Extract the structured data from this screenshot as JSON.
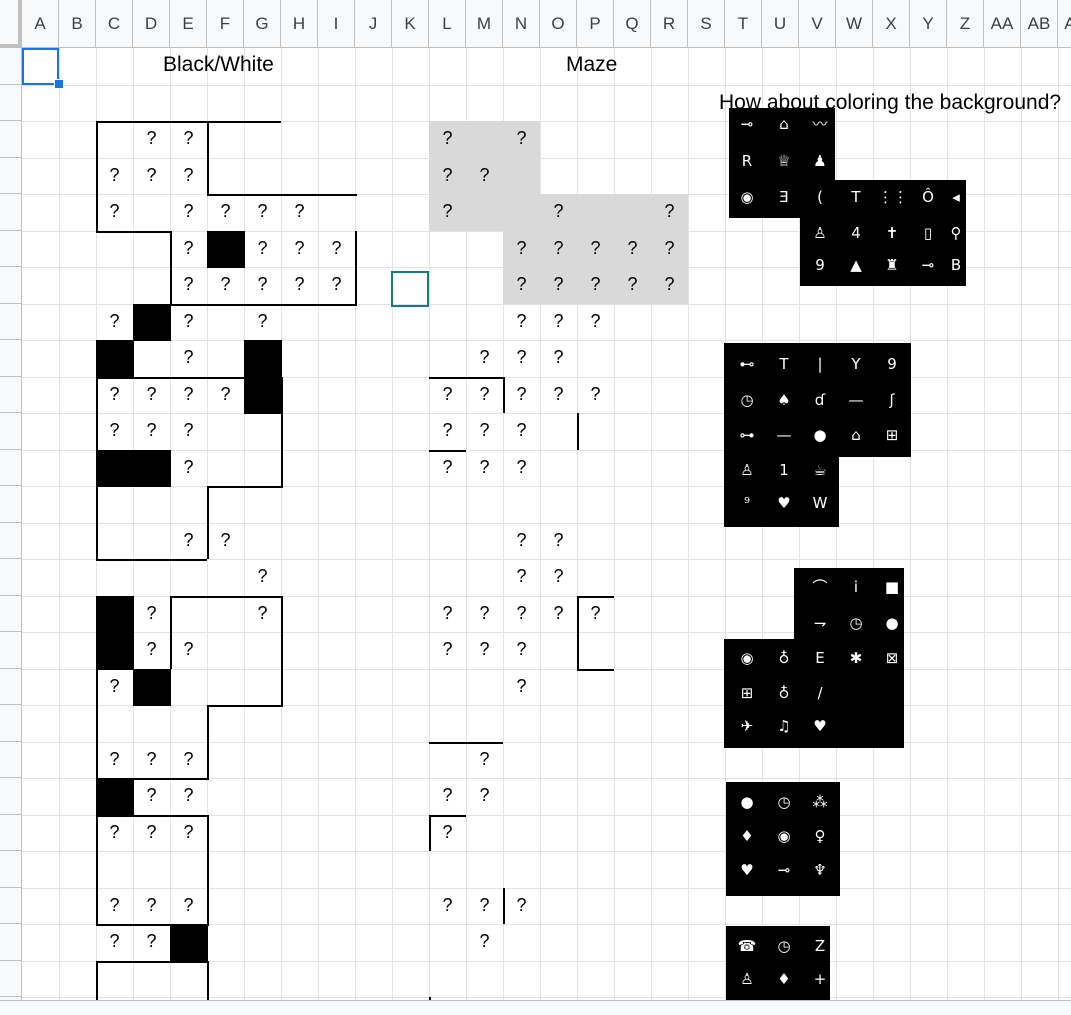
{
  "columns": [
    "A",
    "B",
    "C",
    "D",
    "E",
    "F",
    "G",
    "H",
    "I",
    "J",
    "K",
    "L",
    "M",
    "N",
    "O",
    "P",
    "Q",
    "R",
    "S",
    "T",
    "U",
    "V",
    "W",
    "X",
    "Y",
    "Z",
    "AA",
    "AB",
    "AC"
  ],
  "titles": {
    "black_white": "Black/White",
    "maze": "Maze",
    "coloring_note": "How about coloring the background?"
  },
  "mark": "?",
  "colors": {
    "selection": "#1a73e8",
    "teal_cell": "#137c7c",
    "gray_fill": "#d9d9d9"
  },
  "puzzles_bw": [
    {
      "questions": [
        [
          1,
          3
        ],
        [
          1,
          4
        ],
        [
          2,
          2
        ],
        [
          2,
          3
        ],
        [
          2,
          4
        ],
        [
          3,
          2
        ],
        [
          3,
          4
        ],
        [
          3,
          5
        ],
        [
          3,
          6
        ],
        [
          3,
          7
        ],
        [
          4,
          4
        ],
        [
          4,
          6
        ],
        [
          4,
          7
        ],
        [
          4,
          8
        ],
        [
          5,
          4
        ],
        [
          5,
          5
        ],
        [
          5,
          6
        ],
        [
          5,
          7
        ],
        [
          5,
          8
        ]
      ],
      "blacks": [
        [
          4,
          5
        ]
      ]
    },
    {
      "questions": [
        [
          1,
          2
        ],
        [
          1,
          4
        ],
        [
          1,
          6
        ],
        [
          2,
          4
        ],
        [
          3,
          2
        ],
        [
          3,
          3
        ],
        [
          3,
          4
        ],
        [
          3,
          5
        ],
        [
          4,
          2
        ],
        [
          4,
          3
        ],
        [
          4,
          4
        ],
        [
          5,
          4
        ]
      ],
      "blacks": [
        [
          1,
          3
        ],
        [
          2,
          2
        ],
        [
          2,
          6
        ],
        [
          3,
          6
        ],
        [
          5,
          2
        ],
        [
          5,
          3
        ]
      ]
    },
    {
      "questions": [
        [
          1,
          4
        ],
        [
          1,
          5
        ],
        [
          2,
          6
        ],
        [
          3,
          3
        ],
        [
          3,
          6
        ],
        [
          4,
          3
        ],
        [
          4,
          4
        ],
        [
          5,
          2
        ]
      ],
      "blacks": [
        [
          3,
          2
        ],
        [
          4,
          2
        ],
        [
          5,
          3
        ]
      ]
    },
    {
      "questions": [
        [
          1,
          2
        ],
        [
          1,
          3
        ],
        [
          1,
          4
        ],
        [
          2,
          3
        ],
        [
          2,
          4
        ],
        [
          3,
          2
        ],
        [
          3,
          3
        ],
        [
          3,
          4
        ]
      ],
      "blacks": [
        [
          2,
          2
        ]
      ]
    },
    {
      "questions": [
        [
          1,
          2
        ],
        [
          1,
          3
        ],
        [
          1,
          4
        ],
        [
          2,
          2
        ],
        [
          2,
          3
        ]
      ],
      "blacks": [
        [
          2,
          4
        ]
      ]
    }
  ],
  "puzzles_maze": [
    {
      "questions": [
        [
          1,
          11
        ],
        [
          1,
          13
        ],
        [
          2,
          11
        ],
        [
          2,
          12
        ],
        [
          3,
          11
        ],
        [
          3,
          14
        ],
        [
          3,
          17
        ],
        [
          4,
          13
        ],
        [
          4,
          14
        ],
        [
          4,
          15
        ],
        [
          4,
          16
        ],
        [
          4,
          17
        ],
        [
          5,
          13
        ],
        [
          5,
          14
        ],
        [
          5,
          15
        ],
        [
          5,
          16
        ],
        [
          5,
          17
        ]
      ]
    },
    {
      "questions": [
        [
          1,
          13
        ],
        [
          1,
          14
        ],
        [
          1,
          15
        ],
        [
          2,
          12
        ],
        [
          2,
          13
        ],
        [
          2,
          14
        ],
        [
          3,
          11
        ],
        [
          3,
          12
        ],
        [
          3,
          13
        ],
        [
          3,
          14
        ],
        [
          3,
          15
        ],
        [
          4,
          11
        ],
        [
          4,
          12
        ],
        [
          4,
          13
        ],
        [
          5,
          11
        ],
        [
          5,
          12
        ],
        [
          5,
          13
        ]
      ]
    },
    {
      "questions": [
        [
          1,
          13
        ],
        [
          1,
          14
        ],
        [
          2,
          13
        ],
        [
          2,
          14
        ],
        [
          3,
          11
        ],
        [
          3,
          12
        ],
        [
          3,
          13
        ],
        [
          3,
          14
        ],
        [
          3,
          15
        ],
        [
          4,
          11
        ],
        [
          4,
          12
        ],
        [
          4,
          13
        ],
        [
          5,
          13
        ]
      ]
    },
    {
      "questions": [
        [
          1,
          12
        ],
        [
          2,
          11
        ],
        [
          2,
          12
        ],
        [
          3,
          11
        ]
      ]
    },
    {
      "questions": [
        [
          1,
          11
        ],
        [
          1,
          12
        ],
        [
          1,
          13
        ],
        [
          2,
          12
        ]
      ]
    }
  ],
  "icon_blocks": [
    {
      "icons": [
        "⊸",
        "⌂",
        "〰",
        "R",
        "♕",
        "♟",
        "◉",
        "Ǝ",
        "(",
        "T",
        "⋮⋮",
        "Ô",
        "◂",
        "♙",
        "4",
        "✝",
        "▯",
        "⚲",
        "9",
        "▲",
        "♜",
        "⊸",
        "B"
      ]
    },
    {
      "icons": [
        "⊷",
        "T",
        "|",
        "Y",
        "9",
        "◷",
        "♠",
        "ɗ",
        "—",
        "ʃ",
        "⊶",
        "—",
        "●",
        "⌂",
        "⊞",
        "♙",
        "1",
        "☕",
        "⁹",
        "♥",
        "W"
      ]
    },
    {
      "icons": [
        "⌒",
        "i",
        "■",
        "⇁",
        "◷",
        "●",
        "◉",
        "♁",
        "E",
        "✱",
        "⊠",
        "⊞",
        "♁",
        "/",
        "✈",
        "♫",
        "♥"
      ]
    },
    {
      "icons": [
        "●",
        "◷",
        "⁂",
        "♦",
        "◉",
        "♀",
        "♥",
        "⊸",
        "♆"
      ]
    },
    {
      "icons": [
        "☎",
        "◷",
        "Z",
        "♙",
        "♦",
        "+"
      ]
    }
  ]
}
